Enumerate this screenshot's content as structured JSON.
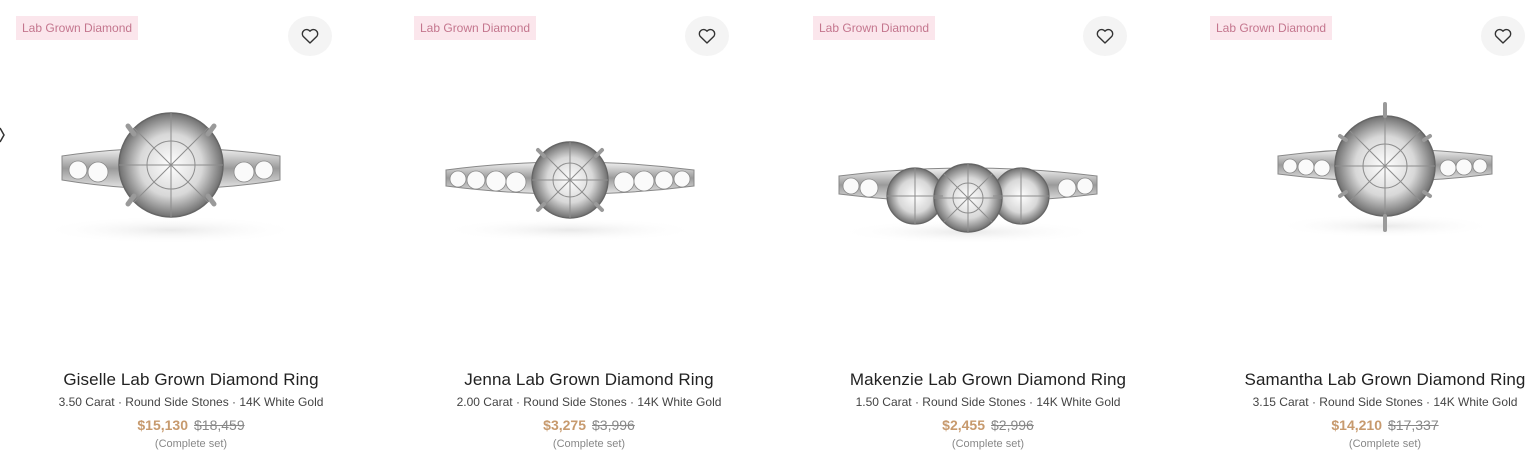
{
  "products": [
    {
      "badge": "Lab Grown Diamond",
      "title": "Giselle Lab Grown Diamond Ring",
      "specs": "3.50 Carat · Round Side Stones · 14K White Gold",
      "price": "$15,130",
      "original_price": "$18,459",
      "note": "(Complete set)",
      "wishlist_icon": "heart-icon"
    },
    {
      "badge": "Lab Grown Diamond",
      "title": "Jenna Lab Grown Diamond Ring",
      "specs": "2.00 Carat · Round Side Stones · 14K White Gold",
      "price": "$3,275",
      "original_price": "$3,996",
      "note": "(Complete set)",
      "wishlist_icon": "heart-icon"
    },
    {
      "badge": "Lab Grown Diamond",
      "title": "Makenzie Lab Grown Diamond Ring",
      "specs": "1.50 Carat · Round Side Stones · 14K White Gold",
      "price": "$2,455",
      "original_price": "$2,996",
      "note": "(Complete set)",
      "wishlist_icon": "heart-icon"
    },
    {
      "badge": "Lab Grown Diamond",
      "title": "Samantha Lab Grown Diamond Ring",
      "specs": "3.15 Carat · Round Side Stones · 14K White Gold",
      "price": "$14,210",
      "original_price": "$17,337",
      "note": "(Complete set)",
      "wishlist_icon": "heart-icon"
    }
  ],
  "colors": {
    "badge_bg": "#fbe6ec",
    "badge_text": "#c4768e",
    "price": "#c79a6e",
    "original_price": "#888888"
  }
}
